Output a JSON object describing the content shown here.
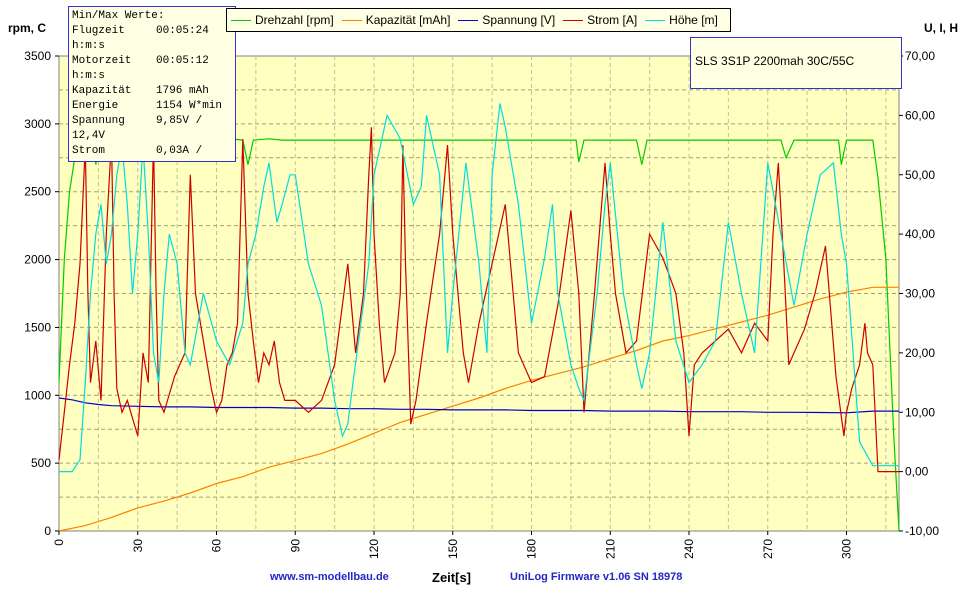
{
  "stats": {
    "title": "Min/Max Werte:",
    "rows": [
      {
        "label": "Flugzeit",
        "value": "00:05:24"
      },
      {
        "label": "h:m:s",
        "value": ""
      },
      {
        "label": "Motorzeit",
        "value": "00:05:12"
      },
      {
        "label": "h:m:s",
        "value": ""
      },
      {
        "label": "Kapazität",
        "value": "1796 mAh"
      },
      {
        "label": "Energie",
        "value": "1154 W*min"
      },
      {
        "label": "Spannung",
        "value": "9,85V /"
      },
      {
        "label": "12,4V",
        "value": ""
      },
      {
        "label": "Strom",
        "value": "0,03A /"
      }
    ]
  },
  "info_box": "SLS 3S1P 2200mah 30C/55C",
  "footer": {
    "left": "www.sm-modellbau.de",
    "right": "UniLog Firmware v1.06 SN 18978"
  },
  "chart_data": {
    "type": "line",
    "xlabel": "Zeit[s]",
    "ylabel_left": "rpm, C",
    "ylabel_right": "U, I, H",
    "xlim": [
      0,
      320
    ],
    "xticks": [
      0,
      30,
      60,
      90,
      120,
      150,
      180,
      210,
      240,
      270,
      300
    ],
    "ylim_left": [
      0,
      3500
    ],
    "yticks_left": [
      "0",
      "500",
      "1000",
      "1500",
      "2000",
      "2500",
      "3000",
      "3500"
    ],
    "ylim_right": [
      -10,
      70
    ],
    "yticks_right": [
      "-10,00",
      "0,00",
      "10,00",
      "20,00",
      "30,00",
      "40,00",
      "50,00",
      "60,00",
      "70,00"
    ],
    "grid": true,
    "legend_position": "top",
    "series": [
      {
        "name": "Drehzahl [rpm]",
        "axis": "left",
        "color": "#00cc00",
        "x": [
          0,
          2,
          4,
          6,
          8,
          10,
          13,
          14,
          16,
          20,
          30,
          40,
          50,
          60,
          70,
          72,
          74,
          80,
          85,
          90,
          100,
          110,
          120,
          130,
          140,
          150,
          160,
          170,
          180,
          190,
          197,
          198,
          200,
          210,
          220,
          222,
          224,
          230,
          240,
          250,
          260,
          270,
          275,
          277,
          280,
          290,
          297,
          298,
          300,
          308,
          310,
          312,
          315,
          318,
          320
        ],
        "y": [
          1100,
          2000,
          2500,
          2750,
          2850,
          2880,
          2880,
          2700,
          2900,
          2900,
          2900,
          2890,
          2890,
          2900,
          2880,
          2700,
          2880,
          2890,
          2880,
          2880,
          2880,
          2880,
          2880,
          2880,
          2880,
          2880,
          2880,
          2880,
          2880,
          2880,
          2880,
          2720,
          2880,
          2880,
          2880,
          2700,
          2880,
          2880,
          2880,
          2880,
          2880,
          2880,
          2880,
          2750,
          2880,
          2880,
          2880,
          2700,
          2880,
          2880,
          2880,
          2600,
          2000,
          700,
          0
        ]
      },
      {
        "name": "Kapazität [mAh]",
        "axis": "left",
        "color": "#ff8000",
        "x": [
          0,
          10,
          20,
          30,
          40,
          50,
          60,
          70,
          80,
          90,
          100,
          110,
          120,
          130,
          140,
          150,
          160,
          170,
          180,
          190,
          200,
          210,
          220,
          230,
          240,
          250,
          260,
          270,
          280,
          290,
          300,
          310,
          320
        ],
        "y": [
          0,
          40,
          100,
          170,
          220,
          280,
          350,
          400,
          470,
          520,
          570,
          640,
          720,
          800,
          860,
          920,
          980,
          1050,
          1110,
          1160,
          1210,
          1270,
          1330,
          1400,
          1440,
          1490,
          1540,
          1590,
          1650,
          1710,
          1760,
          1796,
          1796
        ]
      },
      {
        "name": "Spannung [V]",
        "axis": "right",
        "color": "#0000cc",
        "x": [
          0,
          5,
          10,
          15,
          20,
          30,
          40,
          50,
          60,
          70,
          80,
          90,
          100,
          110,
          120,
          130,
          140,
          150,
          160,
          170,
          180,
          190,
          200,
          210,
          220,
          230,
          240,
          250,
          260,
          270,
          280,
          290,
          300,
          310,
          320
        ],
        "y": [
          12.4,
          12.1,
          11.6,
          11.3,
          11.1,
          11.0,
          10.9,
          10.9,
          10.8,
          10.8,
          10.8,
          10.7,
          10.7,
          10.6,
          10.6,
          10.5,
          10.5,
          10.4,
          10.4,
          10.4,
          10.3,
          10.3,
          10.3,
          10.2,
          10.2,
          10.2,
          10.1,
          10.1,
          10.1,
          10.0,
          10.0,
          9.95,
          9.9,
          10.2,
          10.2
        ]
      },
      {
        "name": "Strom [A]",
        "axis": "right",
        "color": "#cc0000",
        "x": [
          0,
          2,
          4,
          6,
          8,
          10,
          11,
          12,
          14,
          16,
          18,
          20,
          21,
          22,
          24,
          26,
          28,
          30,
          32,
          34,
          36,
          37,
          38,
          40,
          44,
          48,
          50,
          52,
          55,
          58,
          60,
          62,
          64,
          66,
          68,
          70,
          72,
          74,
          76,
          78,
          80,
          82,
          84,
          86,
          90,
          95,
          100,
          105,
          110,
          113,
          116,
          118,
          119,
          120,
          122,
          124,
          128,
          130,
          131,
          132,
          134,
          136,
          140,
          145,
          148,
          150,
          152,
          154,
          156,
          160,
          165,
          170,
          175,
          180,
          185,
          190,
          195,
          198,
          200,
          204,
          208,
          210,
          212,
          216,
          220,
          225,
          230,
          235,
          238,
          240,
          242,
          245,
          250,
          255,
          260,
          265,
          270,
          272,
          274,
          276,
          278,
          280,
          284,
          288,
          292,
          296,
          299,
          300,
          302,
          305,
          307,
          308,
          310,
          312,
          320
        ],
        "y": [
          2,
          10,
          18,
          25,
          35,
          55,
          30,
          15,
          22,
          12,
          40,
          56,
          30,
          14,
          10,
          12,
          9,
          6,
          20,
          15,
          56,
          30,
          12,
          10,
          16,
          20,
          50,
          30,
          22,
          14,
          10,
          12,
          18,
          20,
          25,
          56,
          30,
          22,
          15,
          20,
          18,
          22,
          15,
          12,
          12,
          10,
          12,
          18,
          35,
          20,
          30,
          50,
          58,
          40,
          25,
          15,
          20,
          30,
          55,
          35,
          8,
          12,
          25,
          40,
          55,
          40,
          30,
          20,
          15,
          25,
          35,
          45,
          20,
          15,
          16,
          28,
          44,
          30,
          10,
          30,
          52,
          40,
          30,
          20,
          22,
          40,
          36,
          30,
          20,
          6,
          18,
          20,
          22,
          24,
          20,
          25,
          22,
          40,
          52,
          36,
          18,
          20,
          24,
          30,
          38,
          16,
          6,
          10,
          14,
          18,
          25,
          20,
          18,
          0,
          0
        ]
      },
      {
        "name": "Höhe [m]",
        "axis": "right",
        "color": "#00dddd",
        "x": [
          0,
          5,
          8,
          10,
          12,
          14,
          16,
          18,
          20,
          22,
          24,
          26,
          28,
          30,
          32,
          34,
          36,
          38,
          40,
          42,
          45,
          48,
          50,
          55,
          60,
          65,
          70,
          72,
          75,
          78,
          80,
          83,
          85,
          88,
          90,
          95,
          100,
          105,
          108,
          110,
          112,
          115,
          118,
          120,
          125,
          130,
          135,
          138,
          140,
          145,
          148,
          150,
          155,
          160,
          163,
          165,
          168,
          170,
          175,
          180,
          185,
          188,
          190,
          195,
          198,
          200,
          205,
          208,
          210,
          215,
          220,
          222,
          225,
          230,
          235,
          240,
          245,
          250,
          255,
          260,
          265,
          270,
          275,
          280,
          285,
          290,
          295,
          298,
          300,
          305,
          310,
          320
        ],
        "y": [
          0,
          0,
          2,
          15,
          30,
          40,
          45,
          35,
          40,
          50,
          55,
          45,
          30,
          40,
          55,
          40,
          20,
          15,
          30,
          40,
          35,
          20,
          18,
          30,
          22,
          18,
          25,
          35,
          40,
          48,
          52,
          42,
          45,
          50,
          50,
          35,
          28,
          12,
          6,
          8,
          15,
          25,
          35,
          50,
          60,
          56,
          45,
          48,
          60,
          50,
          20,
          30,
          52,
          35,
          20,
          50,
          62,
          58,
          45,
          25,
          36,
          45,
          30,
          18,
          14,
          12,
          30,
          45,
          52,
          30,
          18,
          14,
          20,
          42,
          22,
          15,
          18,
          22,
          42,
          30,
          20,
          52,
          40,
          28,
          40,
          50,
          52,
          40,
          35,
          5,
          1,
          1
        ]
      }
    ]
  }
}
